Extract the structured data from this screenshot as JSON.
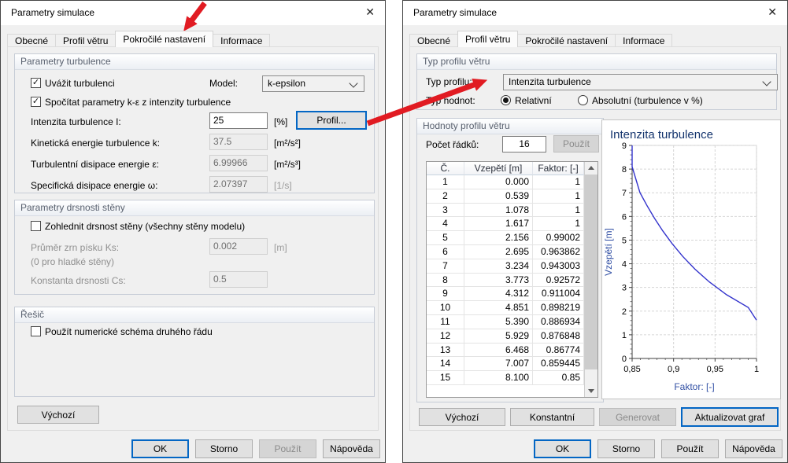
{
  "colors": {
    "arrow_red": "#e11b22",
    "focus_blue": "#0366c4",
    "curve_blue": "#3333cc",
    "chart_title_navy": "#15356e",
    "chart_axis_label_blue": "#3351a5"
  },
  "icons": {
    "close": "✕",
    "checkmark": "✓"
  },
  "left_dialog": {
    "title": "Parametry simulace",
    "tabs": [
      "Obecné",
      "Profil větru",
      "Pokročilé nastavení",
      "Informace"
    ],
    "active_tab": "Pokročilé nastavení",
    "turbulence_group": {
      "title": "Parametry turbulence",
      "consider_turbulence": {
        "label": "Uvážit turbulenci",
        "checked": true
      },
      "model_label": "Model:",
      "model_value": "k-epsilon",
      "compute_ke": {
        "label": "Spočítat parametry k-ε z intenzity turbulence",
        "checked": true
      },
      "intensity": {
        "label": "Intenzita turbulence I:",
        "value": "25",
        "unit": "[%]"
      },
      "profile_button": "Profil...",
      "kinetic": {
        "label": "Kinetická energie turbulence k:",
        "value": "37.5",
        "unit": "[m²/s²]"
      },
      "dissipation": {
        "label": "Turbulentní disipace energie ε:",
        "value": "6.99966",
        "unit": "[m²/s³]"
      },
      "specific": {
        "label": "Specifická disipace energie ω:",
        "value": "2.07397",
        "unit": "[1/s]"
      }
    },
    "roughness_group": {
      "title": "Parametry drsnosti stěny",
      "enable": {
        "label": "Zohlednit drsnost stěny (všechny stěny modelu)",
        "checked": false
      },
      "ks": {
        "label": "Průměr zrn písku Ks:",
        "note": "(0 pro hladké stěny)",
        "value": "0.002",
        "unit": "[m]"
      },
      "cs": {
        "label": "Konstanta drsnosti Cs:",
        "value": "0.5"
      }
    },
    "solver_group": {
      "title": "Řešič",
      "second_order": {
        "label": "Použít numerické schéma druhého řádu",
        "checked": false
      }
    },
    "default_button": "Výchozí",
    "footer": {
      "ok": "OK",
      "cancel": "Storno",
      "apply": "Použít",
      "help": "Nápověda"
    }
  },
  "right_dialog": {
    "title": "Parametry simulace",
    "tabs": [
      "Obecné",
      "Profil větru",
      "Pokročilé nastavení",
      "Informace"
    ],
    "active_tab": "Profil větru",
    "profile_type_group": {
      "title": "Typ profilu větru",
      "type_label": "Typ profilu:",
      "type_value": "Intenzita turbulence",
      "values_label": "Typ hodnot:",
      "radio_relative": {
        "label": "Relativní",
        "selected": true
      },
      "radio_absolute": {
        "label": "Absolutní (turbulence v %)",
        "selected": false
      }
    },
    "values_group": {
      "title": "Hodnoty profilu větru",
      "rows_label": "Počet řádků:",
      "rows_value": "16",
      "apply_button": "Použít",
      "table": {
        "headers": [
          "Č.",
          "Vzepětí [m]",
          "Faktor: [-]"
        ],
        "rows": [
          [
            "1",
            "0.000",
            "1"
          ],
          [
            "2",
            "0.539",
            "1"
          ],
          [
            "3",
            "1.078",
            "1"
          ],
          [
            "4",
            "1.617",
            "1"
          ],
          [
            "5",
            "2.156",
            "0.99002"
          ],
          [
            "6",
            "2.695",
            "0.963862"
          ],
          [
            "7",
            "3.234",
            "0.943003"
          ],
          [
            "8",
            "3.773",
            "0.92572"
          ],
          [
            "9",
            "4.312",
            "0.911004"
          ],
          [
            "10",
            "4.851",
            "0.898219"
          ],
          [
            "11",
            "5.390",
            "0.886934"
          ],
          [
            "12",
            "5.929",
            "0.876848"
          ],
          [
            "13",
            "6.468",
            "0.86774"
          ],
          [
            "14",
            "7.007",
            "0.859445"
          ],
          [
            "15",
            "8.100",
            "0.85"
          ]
        ]
      }
    },
    "chart_buttons": {
      "default": "Výchozí",
      "constant": "Konstantní",
      "generate": "Generovat",
      "update_chart": "Aktualizovat graf"
    },
    "footer": {
      "ok": "OK",
      "cancel": "Storno",
      "apply": "Použít",
      "help": "Nápověda"
    }
  },
  "chart_data": {
    "type": "line",
    "title": "Intenzita turbulence",
    "xlabel": "Faktor: [-]",
    "ylabel": "Vzepětí [m]",
    "xlim": [
      0.85,
      1.0
    ],
    "ylim": [
      0,
      9
    ],
    "xticks": [
      0.85,
      0.9,
      0.95,
      1.0
    ],
    "xtick_labels": [
      "0,85",
      "0,9",
      "0,95",
      "1"
    ],
    "yticks": [
      0,
      1,
      2,
      3,
      4,
      5,
      6,
      7,
      8,
      9
    ],
    "grid": "dashed",
    "legend": "none",
    "series": [
      {
        "name": "Intenzita turbulence",
        "x": [
          0.85,
          0.85,
          0.859445,
          0.86774,
          0.876848,
          0.886934,
          0.898219,
          0.911004,
          0.92572,
          0.943003,
          0.963862,
          0.99002,
          1.0,
          1.0,
          1.0,
          1.0
        ],
        "y": [
          9.0,
          8.1,
          7.007,
          6.468,
          5.929,
          5.39,
          4.851,
          4.312,
          3.773,
          3.234,
          2.695,
          2.156,
          1.617,
          1.078,
          0.539,
          0.0
        ]
      }
    ]
  },
  "annotations": {
    "arrows": [
      {
        "name": "arrow-to-advanced-tab",
        "points_to": "Pokročilé nastavení tab"
      },
      {
        "name": "arrow-profil-to-combo",
        "points_to": "Typ profilu dropdown"
      }
    ]
  }
}
